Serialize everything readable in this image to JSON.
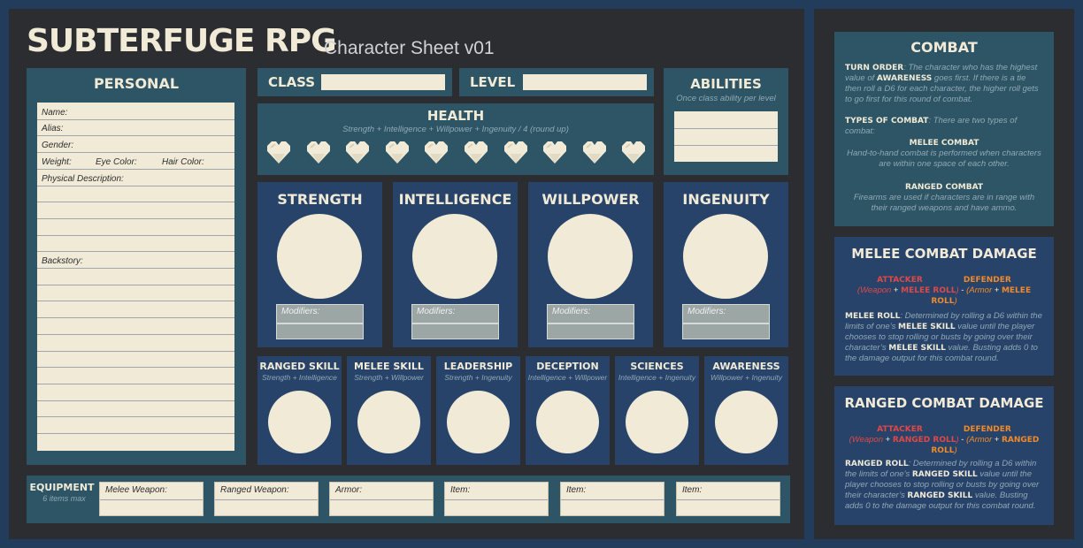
{
  "header": {
    "title": "SUBTERFUGE RPG",
    "subtitle": "Character Sheet v01"
  },
  "personal": {
    "title": "PERSONAL",
    "name_label": "Name:",
    "alias_label": "Alias:",
    "gender_label": "Gender:",
    "weight_label": "Weight:",
    "eye_label": "Eye Color:",
    "hair_label": "Hair Color:",
    "physical_label": "Physical Description:",
    "backstory_label": "Backstory:"
  },
  "class": {
    "label": "CLASS"
  },
  "level": {
    "label": "LEVEL"
  },
  "abilities": {
    "title": "ABILITIES",
    "subtitle": "Once class ability per level"
  },
  "health": {
    "title": "HEALTH",
    "formula": "Strength + Intelligence + Willpower + Ingenuity / 4 (round up)",
    "heart_icon": "heart-icon",
    "heart_count": 10
  },
  "attributes": [
    {
      "name": "STRENGTH",
      "modifiers_label": "Modifiers:"
    },
    {
      "name": "INTELLIGENCE",
      "modifiers_label": "Modifiers:"
    },
    {
      "name": "WILLPOWER",
      "modifiers_label": "Modifiers:"
    },
    {
      "name": "INGENUITY",
      "modifiers_label": "Modifiers:"
    }
  ],
  "skills": [
    {
      "name": "RANGED SKILL",
      "formula": "Strength + Intelligence"
    },
    {
      "name": "MELEE SKILL",
      "formula": "Strength + Willpower"
    },
    {
      "name": "LEADERSHIP",
      "formula": "Strength + Ingenuity"
    },
    {
      "name": "DECEPTION",
      "formula": "Intelligence + Willpower"
    },
    {
      "name": "SCIENCES",
      "formula": "Intelligence + Ingenuity"
    },
    {
      "name": "AWARENESS",
      "formula": "Willpower + Ingenuity"
    }
  ],
  "equipment": {
    "title": "EQUIPMENT",
    "subtitle": "6 items max",
    "slots": [
      "Melee Weapon:",
      "Ranged Weapon:",
      "Armor:",
      "Item:",
      "Item:",
      "Item:"
    ]
  },
  "combat": {
    "title": "COMBAT",
    "turn_order_label": "TURN ORDER",
    "turn_order_pre": ": The character who has the highest value of ",
    "turn_order_awareness": "AWARENESS",
    "turn_order_post": " goes first. If there is a tie then roll a D6 for each character, the higher roll gets to go first for this round of combat.",
    "types_label": "TYPES OF COMBAT",
    "types_text": ": There are two types of combat:",
    "melee_title": "MELEE COMBAT",
    "melee_text": "Hand-to-hand combat is performed when characters  are within one space of each other.",
    "ranged_title": "RANGED COMBAT",
    "ranged_text": "Firearms are used if characters are in range with their ranged weapons and have ammo."
  },
  "melee_damage": {
    "title": "MELEE COMBAT DAMAGE",
    "attacker": "ATTACKER",
    "defender": "DEFENDER",
    "weapon": "Weapon",
    "roll": "MELEE ROLL",
    "armor": "Armor",
    "desc_label": "MELEE ROLL",
    "desc_1": ": Determined by rolling a D6 within the limits of one’s ",
    "desc_skill": "MELEE SKILL",
    "desc_2": " value until the player chooses to stop rolling or busts by going over their character’s ",
    "desc_skill2": "MELEE SKILL",
    "desc_3": " value. Busting adds 0 to the damage output for this combat round."
  },
  "ranged_damage": {
    "title": "RANGED COMBAT DAMAGE",
    "attacker": "ATTACKER",
    "defender": "DEFENDER",
    "weapon": "Weapon",
    "roll": "RANGED ROLL",
    "armor": "Armor",
    "desc_label": "RANGED ROLL",
    "desc_1": ": Determined by rolling a D6 within the limits of one’s ",
    "desc_skill": "RANGED SKILL",
    "desc_2": " value until the player chooses to stop rolling or busts by going over their character’s ",
    "desc_skill2": "RANGED SKILL",
    "desc_3": " value. Busting adds 0 to the damage output for this combat round."
  },
  "colors": {
    "cream": "#f1ead6",
    "teal": "#2e5565",
    "navy": "#27436a",
    "dark": "#2b2d31",
    "orange": "#f08a2b",
    "red": "#e04848"
  }
}
